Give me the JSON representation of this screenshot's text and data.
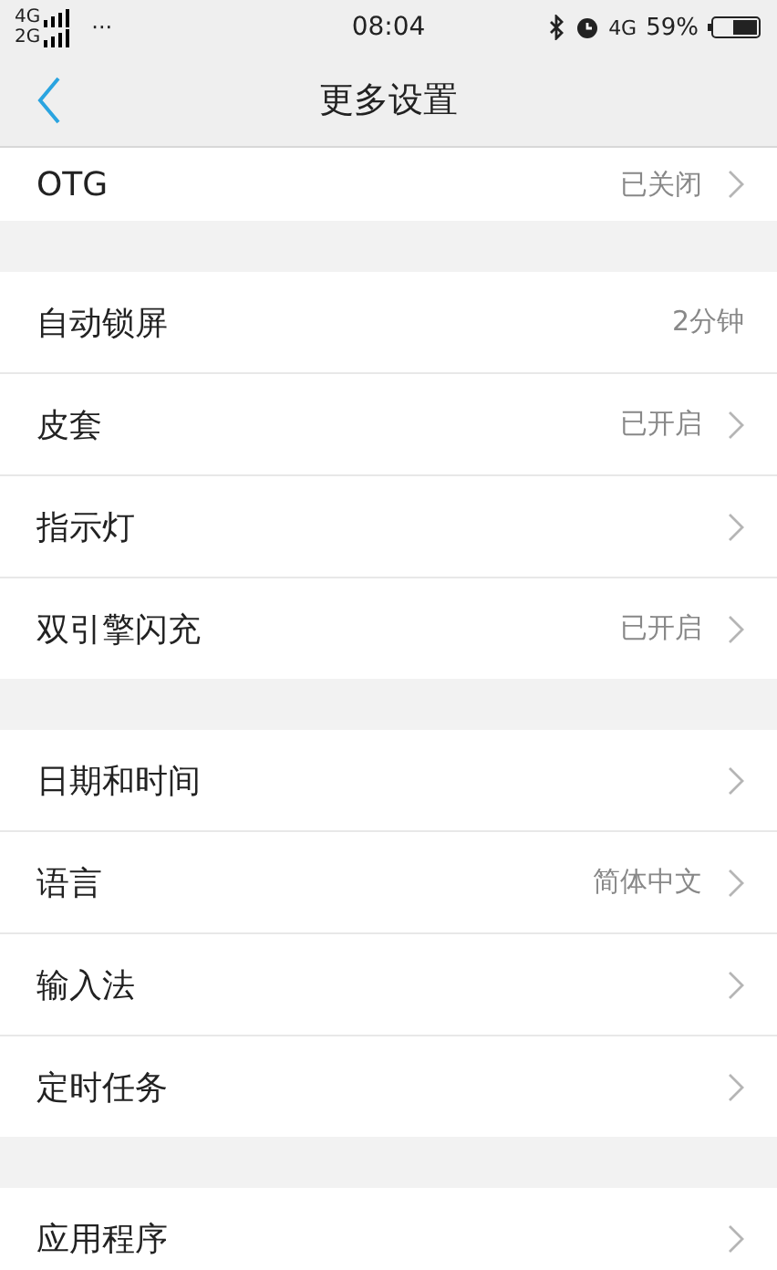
{
  "status_bar": {
    "network_top": "4G",
    "network_bottom": "2G",
    "more": "···",
    "time": "08:04",
    "data": "4G",
    "battery": "59%"
  },
  "header": {
    "title": "更多设置"
  },
  "sections": [
    {
      "items": [
        {
          "label": "OTG",
          "value": "已关闭",
          "chevron": true
        }
      ]
    },
    {
      "items": [
        {
          "label": "自动锁屏",
          "value": "2分钟",
          "chevron": false
        },
        {
          "label": "皮套",
          "value": "已开启",
          "chevron": true
        },
        {
          "label": "指示灯",
          "chevron": true
        },
        {
          "label": "双引擎闪充",
          "value": "已开启",
          "chevron": true
        }
      ]
    },
    {
      "items": [
        {
          "label": "日期和时间",
          "chevron": true
        },
        {
          "label": "语言",
          "value": "简体中文",
          "chevron": true
        },
        {
          "label": "输入法",
          "chevron": true
        },
        {
          "label": "定时任务",
          "chevron": true
        }
      ]
    },
    {
      "items": [
        {
          "label": "应用程序",
          "chevron": true
        }
      ]
    }
  ]
}
